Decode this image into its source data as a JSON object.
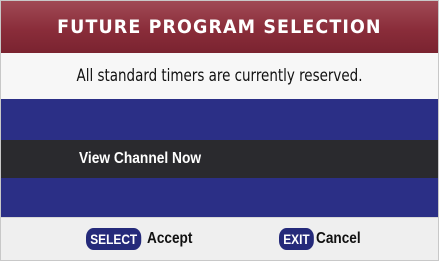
{
  "dialog": {
    "title": "FUTURE PROGRAM SELECTION",
    "message": "All standard timers are currently reserved.",
    "menu_items": [
      "",
      "View Channel Now",
      ""
    ],
    "selected_index": 1
  },
  "footer": {
    "select_key": "SELECT",
    "select_action": "Accept",
    "exit_key": "EXIT",
    "exit_action": "Cancel"
  },
  "colors": {
    "title_bar": "#8a2d3a",
    "menu_background": "#2b2f86",
    "highlight_row": "#2a2a2e",
    "key_badge": "#252a7a"
  }
}
